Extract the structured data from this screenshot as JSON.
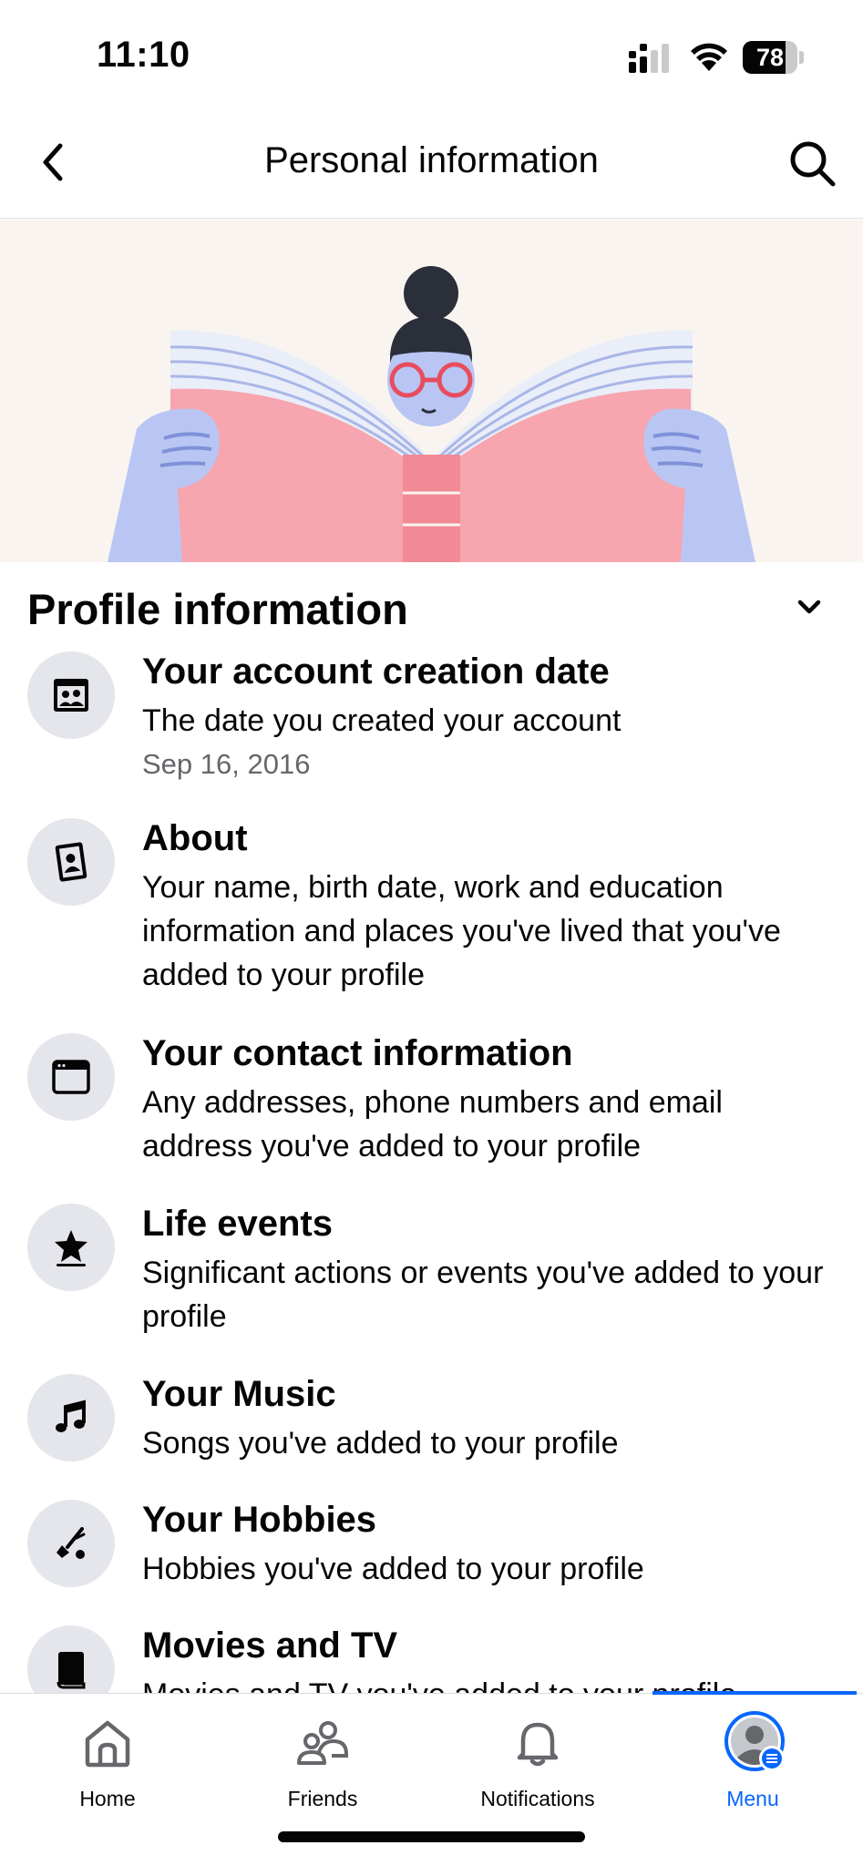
{
  "status_bar": {
    "time": "11:10",
    "battery_percent": "78",
    "battery_level": 0.78
  },
  "header": {
    "title": "Personal information",
    "back_icon": "chevron-left-icon",
    "search_icon": "search-icon"
  },
  "section": {
    "title": "Profile information",
    "chevron_icon": "chevron-down-icon"
  },
  "items": [
    {
      "icon": "profile-card-icon",
      "title": "Your account creation date",
      "description": "The date you created your account",
      "date": "Sep 16, 2016"
    },
    {
      "icon": "portrait-icon",
      "title": "About",
      "description": "Your name, birth date, work and education information and places you've lived that you've added to your profile"
    },
    {
      "icon": "browser-window-icon",
      "title": "Your contact information",
      "description": "Any addresses, phone numbers and email address you've added to your profile"
    },
    {
      "icon": "star-icon",
      "title": "Life events",
      "description": "Significant actions or events you've added to your profile"
    },
    {
      "icon": "music-note-icon",
      "title": "Your Music",
      "description": "Songs you've added to your profile"
    },
    {
      "icon": "hobbies-icon",
      "title": "Your Hobbies",
      "description": "Hobbies you've added to your profile"
    },
    {
      "icon": "book-icon",
      "title": "Movies and TV",
      "description": "Movies and TV you've added to your profile"
    }
  ],
  "tabs": [
    {
      "label": "Home",
      "icon": "home-icon",
      "active": false
    },
    {
      "label": "Friends",
      "icon": "friends-icon",
      "active": false
    },
    {
      "label": "Notifications",
      "icon": "bell-icon",
      "active": false
    },
    {
      "label": "Menu",
      "icon": "avatar-menu-icon",
      "active": true
    }
  ],
  "colors": {
    "accent": "#0866ff",
    "text_primary": "#050505",
    "text_secondary": "#65676b",
    "icon_circle": "#e4e6eb",
    "hero_background": "#faf4f0"
  }
}
